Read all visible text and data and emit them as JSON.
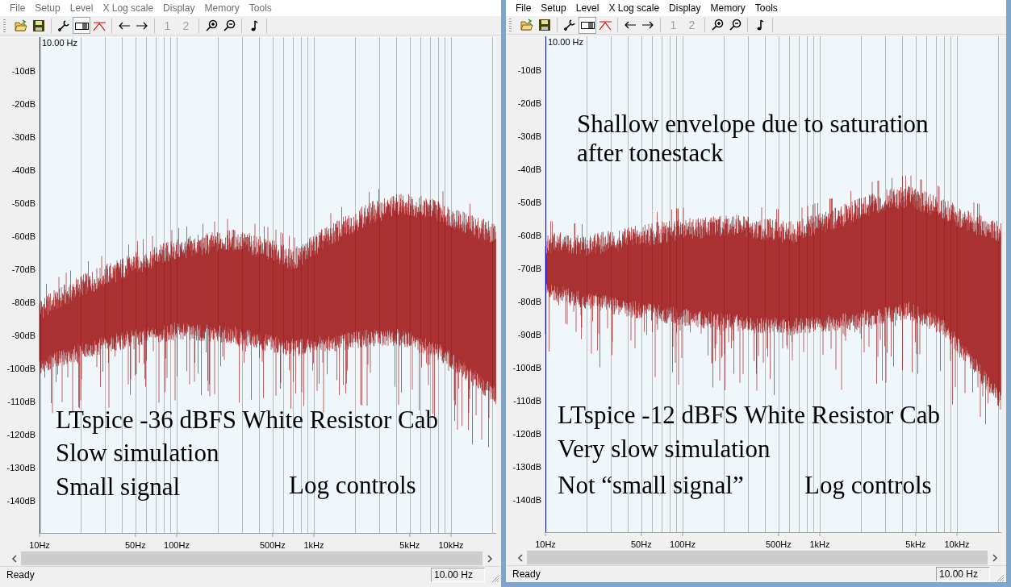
{
  "windows": [
    {
      "active": false,
      "menu": [
        "File",
        "Setup",
        "Level",
        "X Log scale",
        "Display",
        "Memory",
        "Tools"
      ],
      "toolbar": [
        {
          "kind": "open"
        },
        {
          "kind": "save"
        },
        {
          "kind": "separator"
        },
        {
          "kind": "wrench"
        },
        {
          "kind": "bars",
          "pressed": true
        },
        {
          "kind": "peak",
          "pressed": false
        },
        {
          "kind": "separator"
        },
        {
          "kind": "back"
        },
        {
          "kind": "forward"
        },
        {
          "kind": "separator"
        },
        {
          "kind": "memory",
          "label": "1",
          "disabled": true
        },
        {
          "kind": "memory",
          "label": "2",
          "disabled": true
        },
        {
          "kind": "separator"
        },
        {
          "kind": "zoom_in"
        },
        {
          "kind": "zoom_out"
        },
        {
          "kind": "separator"
        },
        {
          "kind": "note"
        },
        {
          "kind": "separator"
        }
      ],
      "plot": {
        "cursor_readout": "10.00 Hz",
        "y_ticks": [
          "-10dB",
          "-20dB",
          "-30dB",
          "-40dB",
          "-50dB",
          "-60dB",
          "-70dB",
          "-80dB",
          "-90dB",
          "-100dB",
          "-110dB",
          "-120dB",
          "-130dB",
          "-140dB"
        ],
        "x_ticks": [
          "10Hz",
          "50Hz",
          "100Hz",
          "500Hz",
          "1kHz",
          "5kHz",
          "10kHz"
        ],
        "annotations": [
          {
            "text": "LTspice -36 dBFS White Resistor Cab"
          },
          {
            "text": "Slow simulation"
          },
          {
            "text": "Small signal"
          },
          {
            "text": "Log controls"
          }
        ]
      },
      "status_bar": {
        "text": "Ready",
        "readout": "10.00 Hz"
      }
    },
    {
      "active": true,
      "menu": [
        "File",
        "Setup",
        "Level",
        "X Log scale",
        "Display",
        "Memory",
        "Tools"
      ],
      "toolbar": [
        {
          "kind": "open"
        },
        {
          "kind": "save"
        },
        {
          "kind": "separator"
        },
        {
          "kind": "wrench"
        },
        {
          "kind": "bars",
          "pressed": true
        },
        {
          "kind": "peak",
          "pressed": false
        },
        {
          "kind": "separator"
        },
        {
          "kind": "back"
        },
        {
          "kind": "forward"
        },
        {
          "kind": "separator"
        },
        {
          "kind": "memory",
          "label": "1",
          "disabled": true
        },
        {
          "kind": "memory",
          "label": "2",
          "disabled": true
        },
        {
          "kind": "separator"
        },
        {
          "kind": "zoom_in"
        },
        {
          "kind": "zoom_out"
        },
        {
          "kind": "separator"
        },
        {
          "kind": "note"
        },
        {
          "kind": "separator"
        }
      ],
      "plot": {
        "cursor_readout": "10.00 Hz",
        "y_ticks": [
          "-10dB",
          "-20dB",
          "-30dB",
          "-40dB",
          "-50dB",
          "-60dB",
          "-70dB",
          "-80dB",
          "-90dB",
          "-100dB",
          "-110dB",
          "-120dB",
          "-130dB",
          "-140dB"
        ],
        "x_ticks": [
          "10Hz",
          "50Hz",
          "100Hz",
          "500Hz",
          "1kHz",
          "5kHz",
          "10kHz"
        ],
        "annotations": [
          {
            "text": "Shallow envelope due to saturation"
          },
          {
            "text": "after tonestack"
          },
          {
            "text": "LTspice -12 dBFS White Resistor Cab"
          },
          {
            "text": "Very slow simulation"
          },
          {
            "text": "Not “small signal”"
          },
          {
            "text": "Log controls"
          }
        ]
      },
      "status_bar": {
        "text": "Ready",
        "readout": "10.00 Hz"
      }
    }
  ]
}
